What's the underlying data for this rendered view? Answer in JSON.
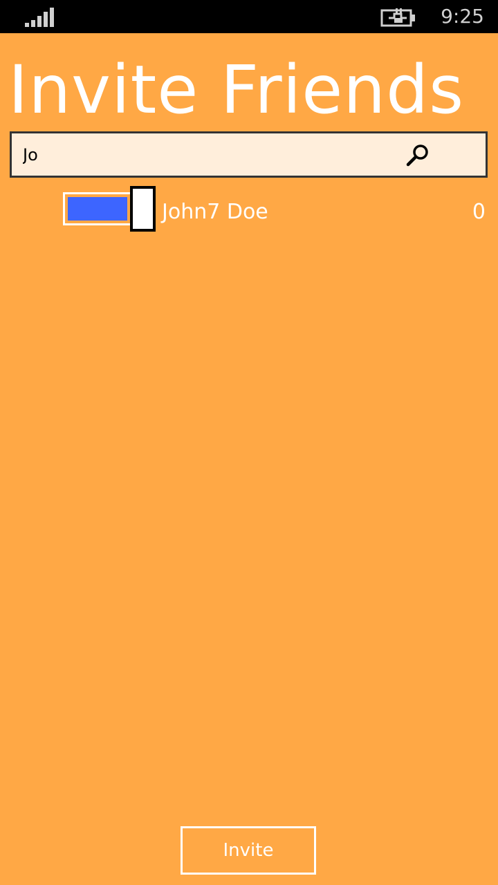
{
  "status_bar": {
    "time": "9:25",
    "signal_icon": "signal-bars-icon",
    "battery_icon": "battery-charging-icon"
  },
  "page": {
    "title": "Invite Friends",
    "background": "#FFA845"
  },
  "search": {
    "value": "Jo",
    "icon": "search-icon",
    "background": "#FFEEDB"
  },
  "friends": [
    {
      "name": "John7 Doe",
      "count": "0",
      "selected": true,
      "toggle_color": "#3D65FF"
    }
  ],
  "actions": {
    "invite_label": "Invite"
  }
}
